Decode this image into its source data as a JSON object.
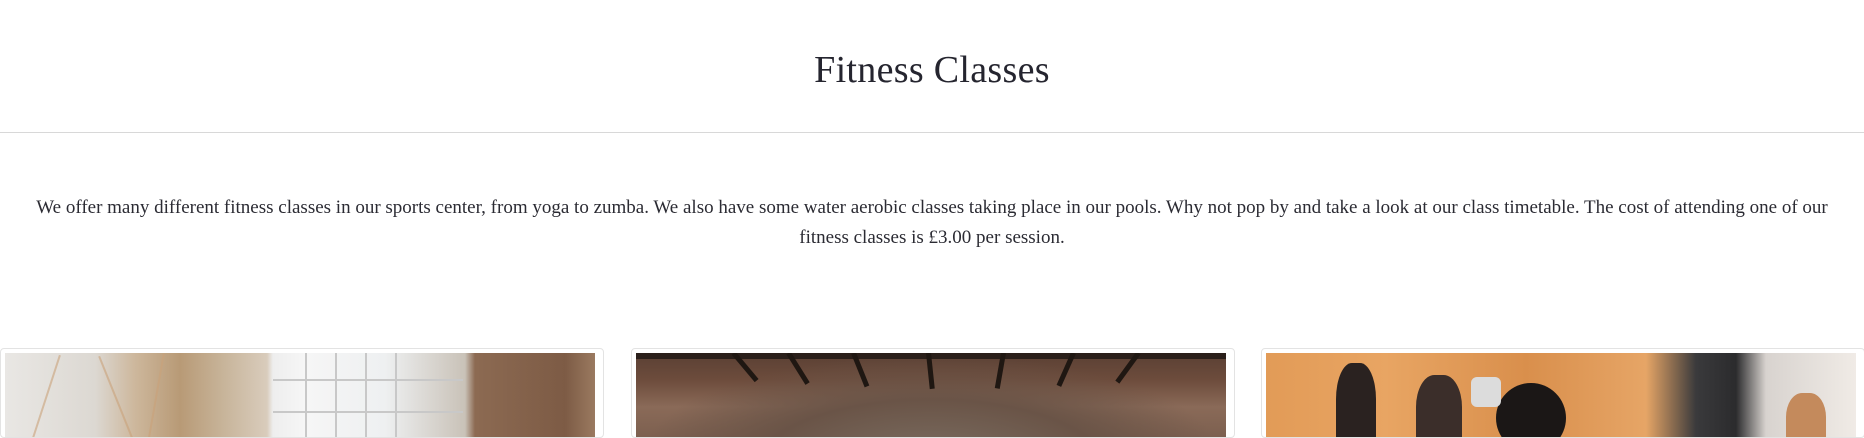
{
  "page": {
    "title": "Fitness Classes",
    "intro": "We offer many different fitness classes in our sports center, from yoga to zumba. We also have some water aerobic classes taking place in our pools. Why not pop by and take a look at our class timetable. The cost of attending one of our fitness classes is £3.00 per session."
  },
  "cards": [
    {
      "image_subject": "yoga-studio-photo"
    },
    {
      "image_subject": "brick-hall-class-photo"
    },
    {
      "image_subject": "zumba-class-photo"
    }
  ],
  "colors": {
    "text": "#2b2b33",
    "divider": "#d8d8d8",
    "card_border": "#e3e3e3"
  }
}
